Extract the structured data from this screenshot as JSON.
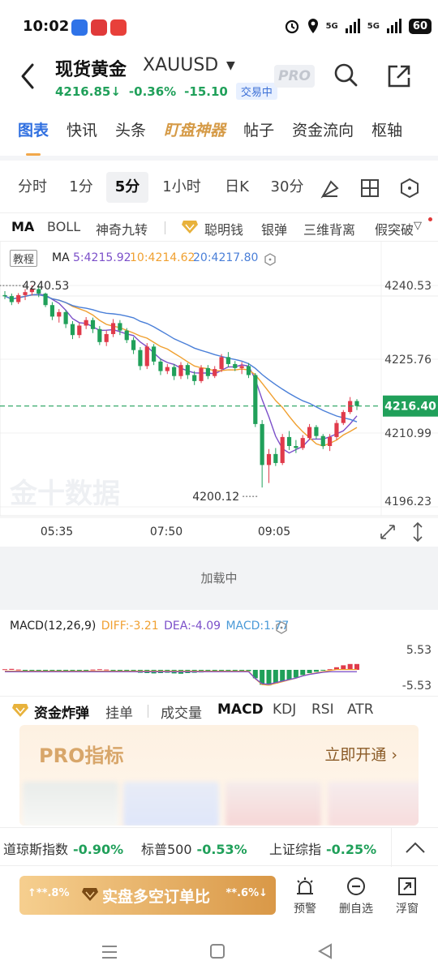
{
  "status": {
    "time": "10:02",
    "net1": "5G",
    "net2": "5G",
    "battery": "60"
  },
  "header": {
    "title": "现货黄金",
    "symbol": "XAUUSD",
    "price": "4216.85",
    "price_arrow": "↓",
    "change_pct": "-0.36%",
    "change": "-15.10",
    "trade_status": "交易中",
    "pro_label": "PRO",
    "price_color": "#20a05a"
  },
  "tabs": [
    {
      "label": "图表"
    },
    {
      "label": "快讯"
    },
    {
      "label": "头条"
    },
    {
      "label": "盯盘神器"
    },
    {
      "label": "帖子"
    },
    {
      "label": "资金流向"
    },
    {
      "label": "枢轴"
    }
  ],
  "periods": [
    "分时",
    "1分",
    "5分",
    "1小时",
    "日K",
    "30分"
  ],
  "period_icons": [
    "draw-tool-icon",
    "layout-grid-icon",
    "settings-hex-icon"
  ],
  "indicators": [
    "MA",
    "BOLL",
    "神奇九转",
    "聪明钱",
    "银弹",
    "三维背离",
    "假突破"
  ],
  "legend": {
    "tutorial": "教程",
    "ma_label": "MA",
    "ma5": "5:4215.92",
    "ma10": "10:4214.62",
    "ma20": "20:4217.80",
    "ma5_color": "#7b4fc9",
    "ma10_color": "#f0a030",
    "ma20_color": "#4a7fd8"
  },
  "chart_data": {
    "type": "candlestick",
    "y_ticks": [
      "4240.53",
      "4225.76",
      "4210.99",
      "4196.23"
    ],
    "ylim": [
      4196.23,
      4240.53
    ],
    "x_ticks": [
      "05:35",
      "07:50",
      "09:05"
    ],
    "high_marker": "4240.53",
    "low_marker": "4200.12",
    "current_price": "4216.40",
    "watermark": "金十数据",
    "up_color": "#e03a4a",
    "down_color": "#20a05a",
    "candles": [
      [
        4238.6,
        4239.4,
        4237.8,
        4238.4
      ],
      [
        4238.4,
        4238.9,
        4236.6,
        4237.2
      ],
      [
        4237.2,
        4239.0,
        4236.8,
        4238.6
      ],
      [
        4238.6,
        4239.8,
        4237.6,
        4239.2
      ],
      [
        4239.2,
        4240.5,
        4238.5,
        4239.8
      ],
      [
        4239.8,
        4240.5,
        4238.2,
        4238.9
      ],
      [
        4238.9,
        4239.1,
        4236.2,
        4236.6
      ],
      [
        4236.6,
        4237.2,
        4233.6,
        4234.3
      ],
      [
        4234.3,
        4235.8,
        4233.1,
        4235.2
      ],
      [
        4235.2,
        4235.6,
        4232.0,
        4232.8
      ],
      [
        4232.8,
        4233.4,
        4229.8,
        4230.6
      ],
      [
        4230.6,
        4233.0,
        4230.0,
        4232.5
      ],
      [
        4232.5,
        4234.2,
        4231.8,
        4233.6
      ],
      [
        4233.6,
        4234.1,
        4231.0,
        4231.8
      ],
      [
        4231.8,
        4232.4,
        4228.6,
        4229.2
      ],
      [
        4229.2,
        4231.5,
        4228.4,
        4230.8
      ],
      [
        4230.8,
        4233.8,
        4230.2,
        4233.0
      ],
      [
        4233.0,
        4233.6,
        4230.6,
        4231.5
      ],
      [
        4231.5,
        4232.0,
        4229.0,
        4229.6
      ],
      [
        4229.6,
        4230.2,
        4226.8,
        4227.6
      ],
      [
        4227.6,
        4228.2,
        4223.6,
        4224.4
      ],
      [
        4224.4,
        4229.0,
        4223.8,
        4228.3
      ],
      [
        4228.3,
        4228.8,
        4224.6,
        4225.3
      ],
      [
        4225.3,
        4225.9,
        4222.6,
        4223.4
      ],
      [
        4223.4,
        4224.8,
        4222.8,
        4224.2
      ],
      [
        4224.2,
        4224.8,
        4221.6,
        4222.4
      ],
      [
        4222.4,
        4225.2,
        4221.8,
        4224.6
      ],
      [
        4224.6,
        4225.0,
        4221.8,
        4222.6
      ],
      [
        4222.6,
        4223.4,
        4220.6,
        4221.4
      ],
      [
        4221.4,
        4224.6,
        4221.0,
        4224.0
      ],
      [
        4224.0,
        4224.6,
        4221.8,
        4222.4
      ],
      [
        4222.4,
        4224.4,
        4222.0,
        4223.8
      ],
      [
        4223.8,
        4226.8,
        4223.2,
        4226.2
      ],
      [
        4226.2,
        4227.2,
        4224.2,
        4224.8
      ],
      [
        4224.8,
        4225.4,
        4223.4,
        4224.0
      ],
      [
        4224.0,
        4225.2,
        4222.8,
        4224.4
      ],
      [
        4224.4,
        4225.0,
        4222.0,
        4222.6
      ],
      [
        4222.6,
        4223.0,
        4212.2,
        4212.8
      ],
      [
        4212.8,
        4213.6,
        4200.1,
        4204.6
      ],
      [
        4204.6,
        4207.8,
        4201.0,
        4206.8
      ],
      [
        4206.8,
        4208.0,
        4204.4,
        4205.0
      ],
      [
        4205.0,
        4210.8,
        4204.6,
        4210.2
      ],
      [
        4210.2,
        4211.4,
        4207.6,
        4208.4
      ],
      [
        4208.4,
        4209.6,
        4207.0,
        4208.0
      ],
      [
        4208.0,
        4210.6,
        4207.6,
        4210.0
      ],
      [
        4210.0,
        4212.8,
        4209.6,
        4212.2
      ],
      [
        4212.2,
        4212.6,
        4209.8,
        4210.4
      ],
      [
        4210.4,
        4210.8,
        4207.8,
        4208.4
      ],
      [
        4208.4,
        4210.8,
        4207.4,
        4210.2
      ],
      [
        4210.2,
        4213.6,
        4209.6,
        4213.0
      ],
      [
        4213.0,
        4215.6,
        4212.6,
        4215.2
      ],
      [
        4215.2,
        4218.2,
        4214.8,
        4217.4
      ],
      [
        4217.4,
        4217.8,
        4215.6,
        4216.4
      ]
    ]
  },
  "loading_text": "加载中",
  "macd": {
    "label": "MACD(12,26,9)",
    "diff": "DIFF:-3.21",
    "dea": "DEA:-4.09",
    "macd": "MACD:1.77",
    "diff_color": "#f0a030",
    "dea_color": "#7b4fc9",
    "macd_color": "#4a9ad8",
    "top_tick": "5.53",
    "bottom_tick": "-5.53",
    "bars": [
      0.2,
      0.3,
      0.1,
      -0.2,
      -0.3,
      -0.4,
      -0.3,
      -0.5,
      -0.6,
      -0.5,
      -0.4,
      -0.3,
      -0.2,
      0.1,
      0.2,
      0.1,
      -0.1,
      -0.3,
      -0.5,
      -0.7,
      -0.9,
      -1.0,
      -1.1,
      -1.0,
      -0.9,
      -1.1,
      -1.2,
      -1.0,
      -0.9,
      -0.8,
      -0.6,
      -0.5,
      -0.3,
      -0.2,
      -0.2,
      -0.1,
      -0.4,
      -2.6,
      -4.6,
      -4.8,
      -4.2,
      -3.6,
      -3.0,
      -2.4,
      -1.6,
      -1.0,
      -0.6,
      -0.2,
      0.2,
      0.8,
      1.4,
      1.8,
      1.8
    ]
  },
  "sub_indicators": [
    "资金炸弹",
    "挂单",
    "成交量",
    "MACD",
    "KDJ",
    "RSI",
    "ATR"
  ],
  "pro_card": {
    "title": "PRO指标",
    "cta": "立即开通"
  },
  "ticker": [
    {
      "name": "道琼斯指数",
      "value": "-0.90%"
    },
    {
      "name": "标普500",
      "value": "-0.53%"
    },
    {
      "name": "上证综指",
      "value": "-0.25%"
    }
  ],
  "bottom": {
    "ratio_left": "↑**.8%",
    "ratio_label": "实盘多空订单比",
    "ratio_right": "**.6%↓",
    "actions": [
      {
        "label": "预警",
        "icon": "alarm-icon"
      },
      {
        "label": "删自选",
        "icon": "remove-circle-icon"
      },
      {
        "label": "浮窗",
        "icon": "float-window-icon"
      }
    ]
  }
}
